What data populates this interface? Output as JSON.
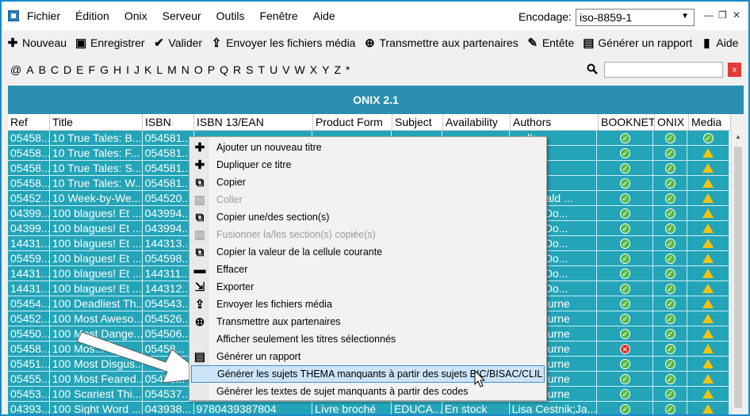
{
  "menu": [
    "Fichier",
    "Édition",
    "Onix",
    "Serveur",
    "Outils",
    "Fenêtre",
    "Aide"
  ],
  "encoding": {
    "label": "Encodage:",
    "value": "iso-8859-1"
  },
  "toolbar": [
    {
      "label": "Nouveau",
      "icon": "plus-icon"
    },
    {
      "label": "Enregistrer",
      "icon": "save-icon"
    },
    {
      "label": "Valider",
      "icon": "check-icon"
    },
    {
      "label": "Envoyer les fichiers média",
      "icon": "upload-icon"
    },
    {
      "label": "Transmettre aux partenaires",
      "icon": "globe-icon"
    },
    {
      "label": "Entête",
      "icon": "pencil-icon"
    },
    {
      "label": "Générer un rapport",
      "icon": "report-icon"
    },
    {
      "label": "Aide",
      "icon": "book-icon"
    }
  ],
  "alphabet": [
    "@",
    "A",
    "B",
    "C",
    "D",
    "E",
    "F",
    "G",
    "H",
    "I",
    "J",
    "K",
    "L",
    "M",
    "N",
    "O",
    "P",
    "Q",
    "R",
    "S",
    "T",
    "U",
    "V",
    "W",
    "X",
    "Y",
    "Z",
    "*"
  ],
  "search": {
    "placeholder": "",
    "clear_label": "x"
  },
  "grid": {
    "title": "ONIX 2.1",
    "columns": [
      "Ref",
      "Title",
      "ISBN",
      "ISBN 13/EAN",
      "Product Form",
      "Subject",
      "Availability",
      "Authors",
      "BOOKNET",
      "ONIX",
      "Media"
    ],
    "rows": [
      {
        "ref": "05458...",
        "title": "10 True Tales: B...",
        "isbn": "054581...",
        "ean": "",
        "form": "",
        "subject": "",
        "avail": "",
        "authors": "...ullo",
        "booknet": "ok",
        "onix": "ok",
        "media": "ok"
      },
      {
        "ref": "05458...",
        "title": "10 True Tales: F...",
        "isbn": "054581...",
        "ean": "",
        "form": "",
        "subject": "",
        "avail": "",
        "authors": "...ullo",
        "booknet": "ok",
        "onix": "ok",
        "media": "warn"
      },
      {
        "ref": "05458...",
        "title": "10 True Tales: S...",
        "isbn": "054581...",
        "ean": "",
        "form": "",
        "subject": "",
        "avail": "",
        "authors": "...ullo",
        "booknet": "ok",
        "onix": "ok",
        "media": "warn"
      },
      {
        "ref": "05458...",
        "title": "10 True Tales: W...",
        "isbn": "054581...",
        "ean": "",
        "form": "",
        "subject": "",
        "avail": "",
        "authors": "...ullo",
        "booknet": "ok",
        "onix": "ok",
        "media": "warn"
      },
      {
        "ref": "05452...",
        "title": "10 Week-by-We...",
        "isbn": "054520...",
        "ean": "",
        "form": "",
        "subject": "",
        "avail": "",
        "authors": "...tzgerald ...",
        "booknet": "ok",
        "onix": "ok",
        "media": "warn"
      },
      {
        "ref": "04399...",
        "title": "100 blagues! Et ...",
        "isbn": "043994...",
        "ean": "",
        "form": "",
        "subject": "",
        "avail": "",
        "authors": "...voie;Do...",
        "booknet": "ok",
        "onix": "ok",
        "media": "warn"
      },
      {
        "ref": "04399...",
        "title": "100 blagues! Et ...",
        "isbn": "043994...",
        "ean": "",
        "form": "",
        "subject": "",
        "avail": "",
        "authors": "...voie;Do...",
        "booknet": "ok",
        "onix": "ok",
        "media": "warn"
      },
      {
        "ref": "14431...",
        "title": "100 blagues! Et ...",
        "isbn": "144313...",
        "ean": "",
        "form": "",
        "subject": "",
        "avail": "",
        "authors": "...voie;Do...",
        "booknet": "ok",
        "onix": "ok",
        "media": "warn"
      },
      {
        "ref": "05459...",
        "title": "100 blagues! Et ...",
        "isbn": "054598...",
        "ean": "",
        "form": "",
        "subject": "",
        "avail": "",
        "authors": "...voie;Do...",
        "booknet": "ok",
        "onix": "ok",
        "media": "warn"
      },
      {
        "ref": "14431...",
        "title": "100 blagues! Et ...",
        "isbn": "144311...",
        "ean": "",
        "form": "",
        "subject": "",
        "avail": "",
        "authors": "...voie;Do...",
        "booknet": "ok",
        "onix": "ok",
        "media": "warn"
      },
      {
        "ref": "14431...",
        "title": "100 blagues! Et ...",
        "isbn": "144312...",
        "ean": "",
        "form": "",
        "subject": "",
        "avail": "",
        "authors": "...voie;Do...",
        "booknet": "ok",
        "onix": "ok",
        "media": "warn"
      },
      {
        "ref": "05454...",
        "title": "100 Deadliest Th...",
        "isbn": "054543...",
        "ean": "",
        "form": "",
        "subject": "",
        "avail": "",
        "authors": "...laybourne",
        "booknet": "ok",
        "onix": "ok",
        "media": "warn"
      },
      {
        "ref": "05452...",
        "title": "100 Most Aweso...",
        "isbn": "054526...",
        "ean": "",
        "form": "",
        "subject": "",
        "avail": "",
        "authors": "...laybourne",
        "booknet": "ok",
        "onix": "ok",
        "media": "warn"
      },
      {
        "ref": "05450...",
        "title": "100 Most Dange...",
        "isbn": "054506...",
        "ean": "",
        "form": "",
        "subject": "",
        "avail": "",
        "authors": "...laybourne",
        "booknet": "ok",
        "onix": "ok",
        "media": "warn"
      },
      {
        "ref": "05458...",
        "title": "100 Mos...",
        "isbn": "05458...",
        "ean": "",
        "form": "",
        "subject": "",
        "avail": "",
        "authors": "...laybourne",
        "booknet": "err",
        "onix": "ok",
        "media": "warn"
      },
      {
        "ref": "05451...",
        "title": "100 Most Disgus...",
        "isbn": "",
        "ean": "",
        "form": "",
        "subject": "",
        "avail": "",
        "authors": "...laybourne",
        "booknet": "ok",
        "onix": "ok",
        "media": "warn"
      },
      {
        "ref": "05455...",
        "title": "100 Most Feared...",
        "isbn": "05455...",
        "ean": "",
        "form": "",
        "subject": "",
        "avail": "",
        "authors": "...laybourne",
        "booknet": "ok",
        "onix": "ok",
        "media": "warn"
      },
      {
        "ref": "05453...",
        "title": "100 Scariest Thi...",
        "isbn": "054537...",
        "ean": "",
        "form": "",
        "subject": "",
        "avail": "",
        "authors": "...laybourne",
        "booknet": "ok",
        "onix": "ok",
        "media": "warn"
      },
      {
        "ref": "04393...",
        "title": "100 Sight Word ...",
        "isbn": "043938...",
        "ean": "9780439387804",
        "form": "Livre broché",
        "subject": "EDUCA...",
        "avail": "En stock",
        "authors": "Lisa Cestnik;Ja...",
        "booknet": "ok",
        "onix": "ok",
        "media": "warn"
      }
    ]
  },
  "context_menu": [
    {
      "label": "Ajouter un nouveau titre",
      "icon": "plus-icon",
      "disabled": false
    },
    {
      "label": "Dupliquer ce titre",
      "icon": "plus-icon",
      "disabled": false
    },
    {
      "label": "Copier",
      "icon": "copy-icon",
      "disabled": false
    },
    {
      "label": "Coller",
      "icon": "paste-icon",
      "disabled": true
    },
    {
      "label": "Copier une/des section(s)",
      "icon": "copy-icon",
      "disabled": false
    },
    {
      "label": "Fusionner la/les section(s) copiée(s)",
      "icon": "paste-icon",
      "disabled": true
    },
    {
      "label": "Copier la valeur de la cellule courante",
      "icon": "copy-icon",
      "disabled": false
    },
    {
      "label": "Effacer",
      "icon": "trash-icon",
      "disabled": false
    },
    {
      "label": "Exporter",
      "icon": "export-icon",
      "disabled": false
    },
    {
      "label": "Envoyer les fichiers média",
      "icon": "upload-icon",
      "disabled": false
    },
    {
      "label": "Transmettre aux partenaires",
      "icon": "globe-icon",
      "disabled": false
    },
    {
      "label": "Afficher seulement les titres sélectionnés",
      "icon": "",
      "disabled": false
    },
    {
      "label": "Générer un rapport",
      "icon": "report-icon",
      "disabled": false
    },
    {
      "label": "Générer les sujets THEMA manquants à partir des sujets BIC/BISAC/CLIL",
      "icon": "",
      "disabled": false,
      "highlighted": true
    },
    {
      "label": "Générer les textes de sujet manquants à partir des codes",
      "icon": "",
      "disabled": false
    }
  ],
  "colors": {
    "row_selected": "#23a4b8",
    "grid_title": "#2a8fb0",
    "highlight": "#cce4f7",
    "window_border": "#1b88c9"
  }
}
